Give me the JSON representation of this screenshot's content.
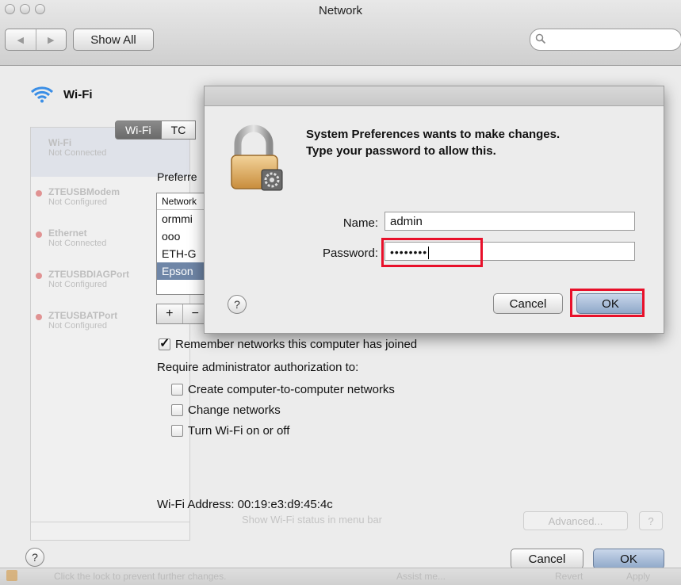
{
  "window": {
    "title": "Network"
  },
  "toolbar": {
    "back_label": "◀",
    "forward_label": "▶",
    "show_all_label": "Show All",
    "search_placeholder": ""
  },
  "interface_header": {
    "label": "Wi-Fi"
  },
  "sidebar": {
    "items": [
      {
        "name": "Wi-Fi",
        "status": "Not Connected"
      },
      {
        "name": "ZTEUSBModem",
        "status": "Not Configured"
      },
      {
        "name": "Ethernet",
        "status": "Not Connected"
      },
      {
        "name": "ZTEUSBDIAGPort",
        "status": "Not Configured"
      },
      {
        "name": "ZTEUSBATPort",
        "status": "Not Configured"
      }
    ]
  },
  "tabs": [
    {
      "label": "Wi-Fi"
    },
    {
      "label": "TC"
    }
  ],
  "preferred": {
    "label": "Preferre",
    "header": "Network",
    "rows": [
      {
        "label": "ormmi"
      },
      {
        "label": "ooo"
      },
      {
        "label": "ETH-G"
      },
      {
        "label": "Epson"
      }
    ],
    "add_label": "+",
    "remove_label": "−"
  },
  "options": {
    "remember_label": "Remember networks this computer has joined",
    "remember_checked": true,
    "require_label": "Require administrator authorization to:",
    "create_label": "Create computer-to-computer networks",
    "change_label": "Change networks",
    "turn_label": "Turn Wi-Fi on or off"
  },
  "wifi_address": "Wi-Fi Address: 00:19:e3:d9:45:4c",
  "background_faded": {
    "show_status": "Show Wi-Fi status in menu bar",
    "advanced_label": "Advanced...",
    "help_q": "?",
    "footer_lock_text": "Click the lock to prevent further changes.",
    "assist_label": "Assist me...",
    "revert_label": "Revert",
    "apply_label": "Apply"
  },
  "main_buttons": {
    "help": "?",
    "cancel": "Cancel",
    "ok": "OK"
  },
  "auth_dialog": {
    "message_line1": "System Preferences wants to make changes.",
    "message_line2": "Type your password to allow this.",
    "name_label": "Name:",
    "name_value": "admin",
    "password_label": "Password:",
    "password_value": "••••••••",
    "help": "?",
    "cancel_label": "Cancel",
    "ok_label": "OK"
  },
  "colors": {
    "highlight": "#e8102a",
    "selection": "#6f86a7",
    "default_button": "#8fa8c9"
  }
}
